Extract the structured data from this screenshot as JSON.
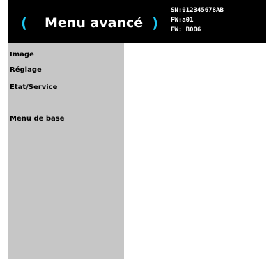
{
  "header": {
    "title": "Menu avancé",
    "bracket_left": "(",
    "bracket_right": ")",
    "serial": "SN:012345678AB",
    "fw_line1": "FW:a01",
    "fw_line2": "FW: B006"
  },
  "menu": {
    "items": [
      {
        "label": "Image"
      },
      {
        "label": "Réglage"
      },
      {
        "label": "Etat/Service"
      },
      {
        "label": "Menu de base"
      }
    ]
  },
  "colors": {
    "header_bg": "#000000",
    "accent": "#1cc6f0",
    "sidebar_bg": "#c6c6c6",
    "content_bg": "#ffffff"
  }
}
